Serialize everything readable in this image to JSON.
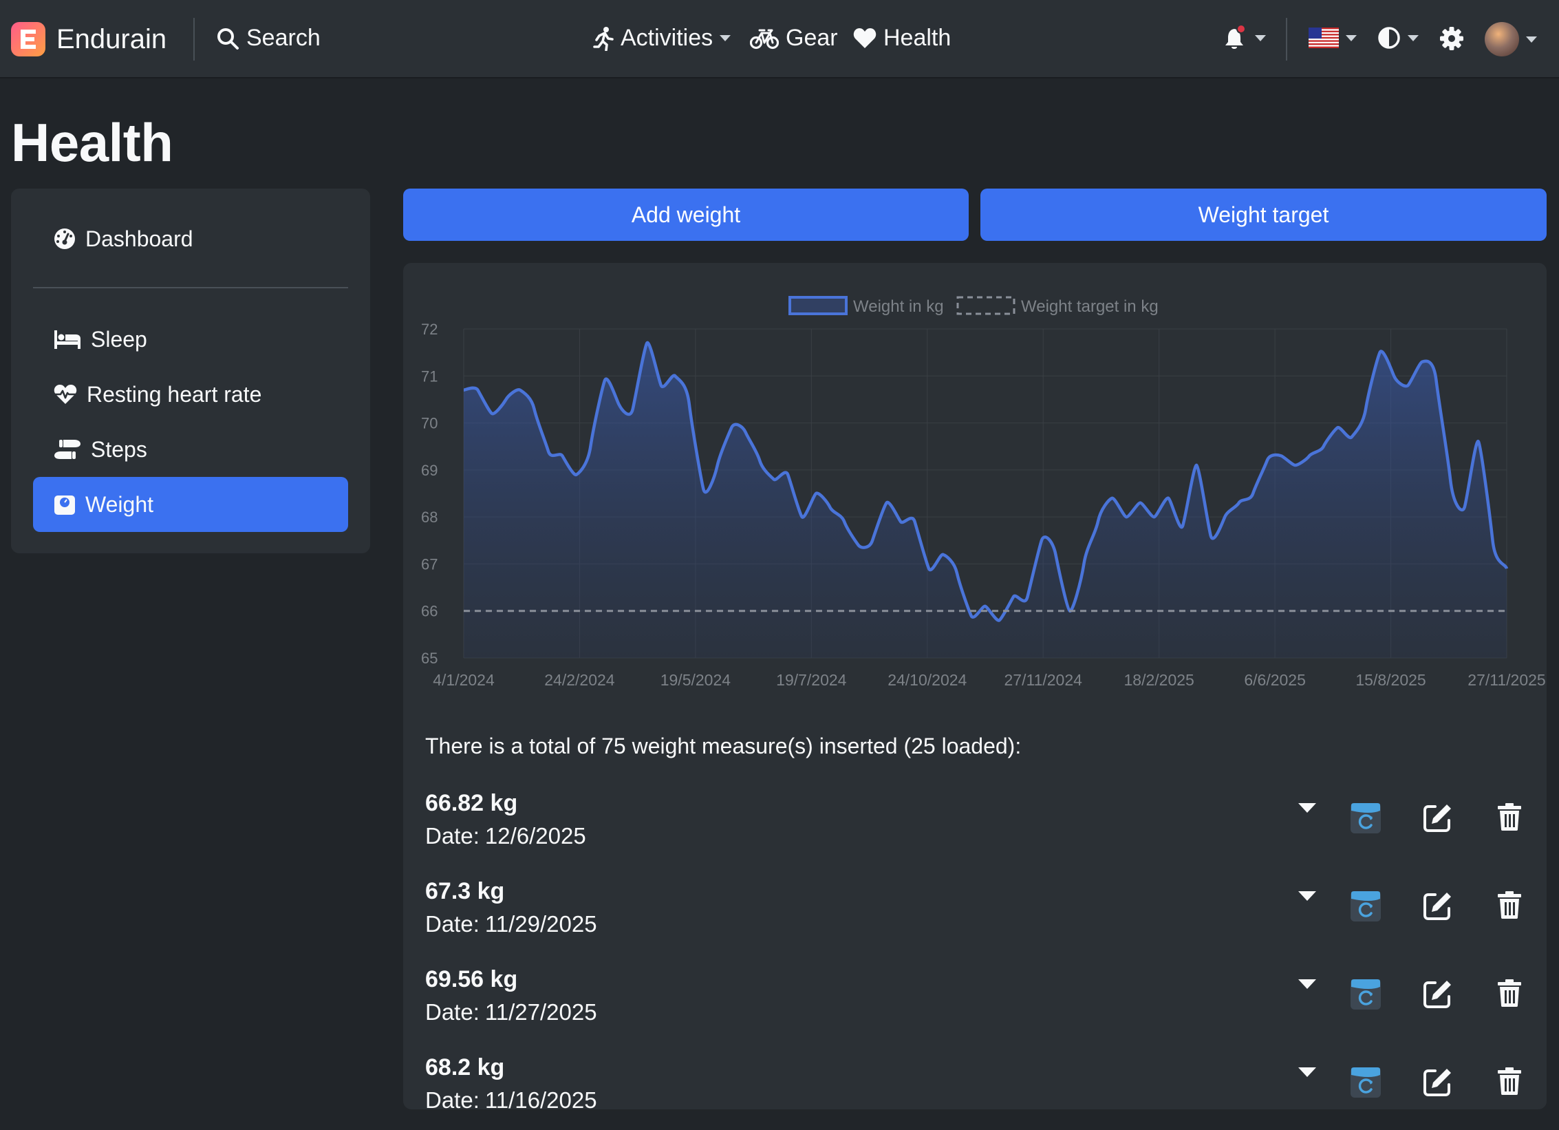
{
  "colors": {
    "accent": "#3b71f0",
    "series_line": "#4a74d9",
    "target_line": "#8a8f99",
    "grid": "#3a3f45",
    "tick_text": "#7d8288",
    "notification": "#dc3545",
    "garmin": "#4aa3df"
  },
  "navbar": {
    "brand": "Endurain",
    "search_label": "Search",
    "activities_label": "Activities",
    "gear_label": "Gear",
    "health_label": "Health",
    "icons": {
      "logo": "endurain-logo-icon",
      "search": "search-icon",
      "activities": "running-icon",
      "gear": "bicycle-icon",
      "health": "heart-icon",
      "notifications": "bell-icon",
      "language": "us-flag-icon",
      "theme": "contrast-icon",
      "settings": "gear-icon",
      "user": "avatar"
    }
  },
  "page": {
    "title": "Health"
  },
  "sidebar": {
    "items": [
      {
        "label": "Dashboard",
        "icon": "gauge-icon",
        "active": false
      },
      {
        "label": "Sleep",
        "icon": "bed-icon",
        "active": false
      },
      {
        "label": "Resting heart rate",
        "icon": "heart-pulse-icon",
        "active": false
      },
      {
        "label": "Steps",
        "icon": "shoe-prints-icon",
        "active": false
      },
      {
        "label": "Weight",
        "icon": "weight-scale-icon",
        "active": true
      }
    ]
  },
  "actions": {
    "add_weight": "Add weight",
    "weight_target": "Weight target"
  },
  "chart_data": {
    "type": "line",
    "title": "",
    "xlabel": "",
    "ylabel": "",
    "legend_position": "top",
    "grid": true,
    "ylim": [
      65,
      72
    ],
    "y_ticks": [
      "65",
      "66",
      "67",
      "68",
      "69",
      "70",
      "71",
      "72"
    ],
    "x_ticks": [
      "4/1/2024",
      "24/2/2024",
      "19/5/2024",
      "19/7/2024",
      "24/10/2024",
      "27/11/2024",
      "18/2/2025",
      "6/6/2025",
      "15/8/2025",
      "27/11/2025"
    ],
    "series": [
      {
        "name": "Weight in kg",
        "fill": true,
        "values": [
          70.7,
          70.7,
          70.2,
          70.5,
          70.7,
          70.3,
          69.4,
          69.3,
          68.9,
          69.5,
          70.9,
          70.4,
          70.3,
          71.7,
          70.8,
          71.0,
          70.4,
          68.6,
          69.1,
          69.9,
          69.8,
          69.2,
          68.8,
          68.9,
          68.0,
          68.5,
          68.2,
          67.9,
          67.4,
          67.5,
          68.3,
          67.9,
          67.9,
          66.9,
          67.2,
          66.8,
          65.9,
          66.1,
          65.8,
          66.3,
          66.3,
          67.5,
          67.2,
          66.0,
          67.0,
          67.9,
          68.4,
          68.0,
          68.3,
          68.0,
          68.4,
          67.8,
          69.1,
          67.6,
          68.0,
          68.3,
          68.5,
          69.2,
          69.3,
          69.1,
          69.3,
          69.5,
          69.9,
          69.7,
          70.3,
          71.5,
          71.0,
          70.8,
          71.3,
          70.9,
          68.8,
          68.2,
          69.6,
          67.5,
          66.9
        ]
      },
      {
        "name": "Weight target in kg",
        "dashed": true,
        "values": [
          66,
          66
        ]
      }
    ]
  },
  "summary": "There is a total of 75 weight measure(s) inserted (25 loaded):",
  "entries": [
    {
      "weight": "66.82 kg",
      "date_label": "Date:",
      "date": "12/6/2025"
    },
    {
      "weight": "67.3 kg",
      "date_label": "Date:",
      "date": "11/29/2025"
    },
    {
      "weight": "69.56 kg",
      "date_label": "Date:",
      "date": "11/27/2025"
    },
    {
      "weight": "68.2 kg",
      "date_label": "Date:",
      "date": "11/16/2025"
    }
  ],
  "entry_icons": {
    "expand": "caret-down-icon",
    "source": "garmin-sync-icon",
    "edit": "edit-icon",
    "delete": "trash-icon"
  }
}
